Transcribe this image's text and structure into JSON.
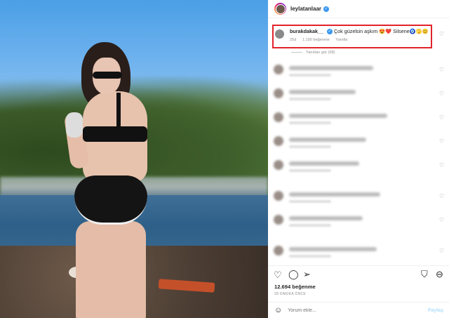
{
  "post": {
    "author": "leylatanlaar",
    "author_verified": true
  },
  "highlighted_comment": {
    "username": "burakdakak__",
    "verified": true,
    "text": "Çok güzelsin aşkım 😍❤️ Silsene🧿🫣😊",
    "age": "25d",
    "likes": "1.190 beğenme",
    "reply_label": "Yanıtla"
  },
  "view_replies": "Yanıtları gör (58)",
  "blurred_comments": [
    {
      "text_width": 120
    },
    {
      "text_width": 95
    },
    {
      "text_width": 140
    },
    {
      "text_width": 110
    },
    {
      "text_width": 100
    },
    {
      "text_width": 130
    },
    {
      "text_width": 105
    },
    {
      "text_width": 125
    }
  ],
  "likes_count": "12.694 beğenme",
  "post_age": "28 DAKİKA ÖNCE",
  "add_comment": {
    "placeholder": "Yorum ekle...",
    "post_label": "Paylaş"
  },
  "colors": {
    "highlight_border": "#e3232b",
    "verified_blue": "#3897f0"
  },
  "icons": [
    "heart-icon",
    "comment-icon",
    "share-icon",
    "bookmark-icon",
    "more-icon",
    "emoji-icon"
  ]
}
